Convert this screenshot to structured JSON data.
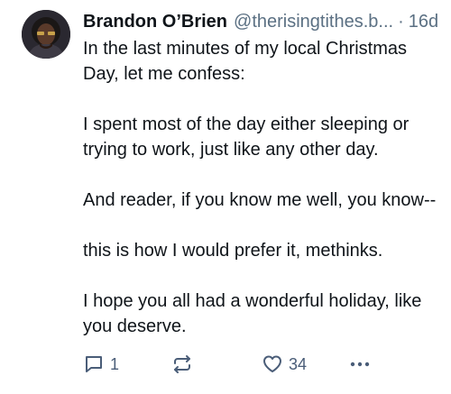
{
  "post": {
    "author": {
      "display_name": "Brandon O’Brien",
      "handle": "@therisingtithes.b...",
      "avatar": "avatar-portrait"
    },
    "separator": "·",
    "age": "16d",
    "paragraphs": [
      "In the last minutes of my local Christmas Day, let me confess:",
      "I spent most of the day either sleeping or trying to work, just like any other day.",
      "And reader, if you know me well, you know--",
      "this is how I would prefer it, methinks.",
      "I hope you all had a wonderful holiday, like you deserve."
    ],
    "actions": {
      "reply": {
        "icon": "reply-icon",
        "count": "1"
      },
      "repost": {
        "icon": "repost-icon"
      },
      "like": {
        "icon": "heart-icon",
        "count": "34"
      },
      "more": {
        "icon": "more-options-icon"
      }
    }
  },
  "colors": {
    "text": "#0f1419",
    "secondary": "#5b7083",
    "action": "#4a5d78",
    "background": "#ffffff"
  }
}
